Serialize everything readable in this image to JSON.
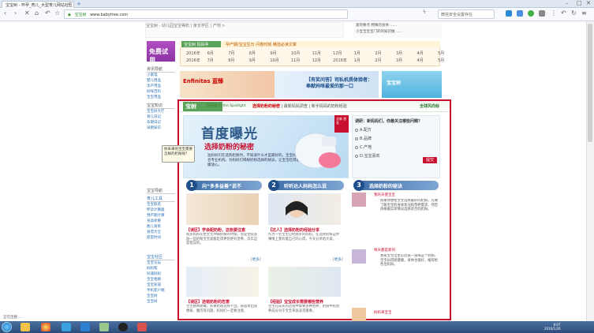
{
  "browser": {
    "tab_title": "宝宝树 - 怀孕_育儿_大型育儿网站社区",
    "new_tab": "+",
    "address_tag": "宝宝树",
    "url": "www.babytree.com",
    "search_placeholder": "微信安全设置存在",
    "status_text": "正在连接..."
  },
  "top_ads": {
    "left": "宝宝树 - 幼儿园宝宝等奶 | 家长学区 | 产地 >",
    "right_1": "爱的要点 特殊的身体 ......",
    "right_2": "小宝宝宝宝门的的知识做 ......"
  },
  "side_trial": "免费试用",
  "calendar": {
    "badge": "宝宝树 妈妈孕",
    "title": "孕产期/宝宝生日 问卷时刻 精选必读文章",
    "row1_year": "2016年",
    "row1": [
      "6月",
      "7月",
      "8月",
      "9月",
      "10月",
      "11月",
      "12月",
      "1月",
      "2月",
      "3月",
      "4月",
      "5月"
    ],
    "row2_year": "2016年",
    "row2": [
      "7月",
      "8月",
      "9月",
      "10月",
      "11月",
      "12月"
    ],
    "row2_year2": "2016年",
    "row2b": [
      "1月",
      "2月",
      "3月",
      "4月",
      "5月",
      "6月"
    ]
  },
  "left_nav": {
    "head1": "资讯导航",
    "items1": [
      "小家电",
      "婴儿用品",
      "孕产用品",
      "妈咪百科",
      "宝宝用品"
    ],
    "head2": "宝宝知识",
    "items2": [
      "宝宝树大厅",
      "育儿日记",
      "孕期日记",
      "早教知识"
    ],
    "head3": "宝宝导航",
    "head4": "育儿工具",
    "items4": [
      "宝宝取名",
      "怀孕计算器",
      "预产期计算",
      "身高体重",
      "胎儿发育",
      "食谱大全",
      "疫苗时间"
    ],
    "head5": "宝宝社区",
    "items5": [
      "宝宝论坛",
      "妈妈帮",
      "同城妈妈",
      "宝宝相册",
      "宝宝知道",
      "手机客户端",
      "宝宝树",
      "宝宝树"
    ]
  },
  "banners": {
    "b1": "Enfinitas 蓝臻",
    "b2_line1": "【有奖问答】司私机质体验者：",
    "b2_line2": "奉献妈咪最爱的那一口",
    "b3": "宝宝树"
  },
  "spotlight": {
    "logo": "宝树",
    "logo_sub": "风向标 in the Spotlight",
    "nav_bold": "选择奶粉的秘密",
    "nav_rest": " | 最新妈妈调查 | 新手妈妈的奶粉经验",
    "right_title": "全球风向标",
    "hero_title": "首度曝光",
    "hero_subtitle": "选择奶粉的秘密",
    "hero_text": "准妈妈们在选购奶粉时，不知道什么才是最好的。宝宝树联合专业机构，为妈妈们揭秘奶粉选择的秘诀，让宝宝吃得健康放心。",
    "ribbon": "全新 首发",
    "bubble": "你未来的宝宝需要怎样的奶粉呢？",
    "survey_q": "调研：新妈妈们，你最关注哪些问题？",
    "survey_opts": [
      "A.配方",
      "B.品牌",
      "C.产地",
      "D.宝宝喜欢"
    ],
    "submit": "提交"
  },
  "sections": {
    "s1_num": "1",
    "s1": "向“多多益善”说不",
    "s2_num": "2",
    "s2": "听听达人妈妈怎么说",
    "s3_num": "3",
    "s3": "选择奶粉的秘诀"
  },
  "articles": {
    "a1_title": "【误区】学会配奶粉，这些要注意",
    "a1_text": "很多妈妈在给宝宝冲调奶粉的时候，总是觉得多放一些奶粉宝宝就能吃得更饱更有营养，其实这是错误的。",
    "a2_title": "【达人】选择奶粉的经验分享",
    "a2_text": "作为一名宝宝已经两岁的妈妈，在选择奶粉这件事情上我有着自己的心得，今天分享给大家。",
    "a3_title": "【误区】选错奶粉的危害",
    "a3_text": "宝宝肠胃娇嫩，如果奶粉选择不当，很容易出现便秘、腹泻等问题，妈妈们一定要注意。",
    "a4_title": "【经验】宝宝成长需要哪些营养",
    "a4_text": "宝宝在成长的过程中需要多种营养，奶粉中的营养成分对于宝宝来说非常重要。",
    "more": "[更多]"
  },
  "right_articles": {
    "r1_title": "我的天使宝宝",
    "r1_text": "如果你想给宝宝选择最好的奶粉，先要了解宝宝的身体状况和营养需求，然后再根据实际情况选择适合的奶粉。",
    "r2_title": "每天都是新的",
    "r2_text": "我家宝宝出生以后就一直喝这个奶粉，宝宝长得很健康，身体也很好，推荐给各位妈妈。",
    "r3_title": "妈妈来宝宝"
  },
  "taskbar": {
    "time": "8:07",
    "date": "2016/1/26"
  }
}
